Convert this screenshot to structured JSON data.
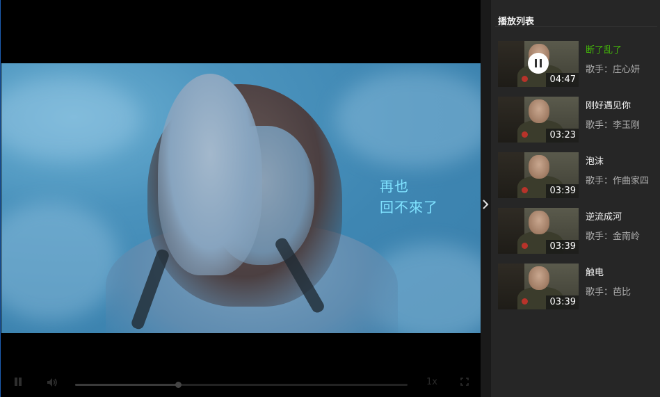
{
  "video": {
    "subtitle_lines": [
      "再也",
      "回不來了"
    ]
  },
  "controls": {
    "play_state": "playing",
    "progress": 0.31,
    "speed_label": "1x"
  },
  "playlist": {
    "title": "播放列表",
    "active_index": 0,
    "items": [
      {
        "title": "断了乱了",
        "artist": "歌手：庄心妍",
        "duration": "04:47"
      },
      {
        "title": "刚好遇见你",
        "artist": "歌手：李玉刚",
        "duration": "03:23"
      },
      {
        "title": "泡沫",
        "artist": "歌手：作曲家四",
        "duration": "03:39"
      },
      {
        "title": "逆流成河",
        "artist": "歌手：金南岭",
        "duration": "03:39"
      },
      {
        "title": "触电",
        "artist": "歌手：芭比",
        "duration": "03:39"
      }
    ]
  },
  "colors": {
    "accent_active": "#43b30a",
    "panel_bg": "#262626",
    "subtitle": "#7fe2ff"
  },
  "icons": {
    "play_pause": "pause-icon",
    "volume": "volume-icon",
    "fullscreen": "fullscreen-icon",
    "collapse": "chevron-right-icon"
  }
}
